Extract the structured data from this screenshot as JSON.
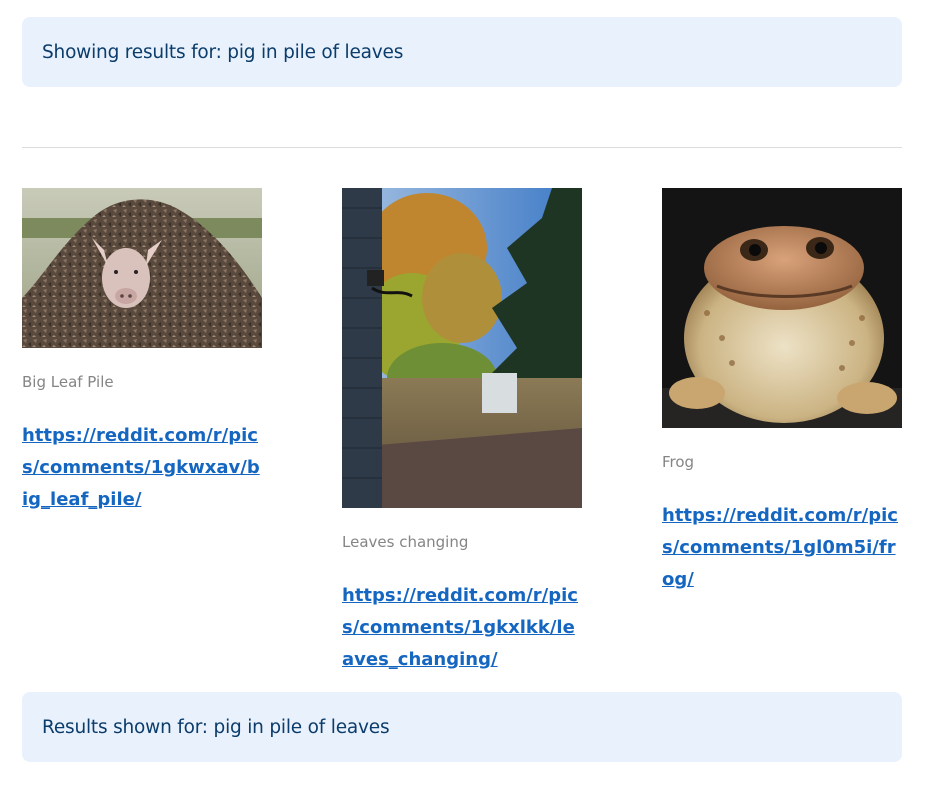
{
  "header": {
    "showing_results": "Showing results for: pig in pile of leaves"
  },
  "results": [
    {
      "title": "Big Leaf Pile",
      "url": "https://reddit.com/r/pics/comments/1gkwxav/big_leaf_pile/",
      "image_alt": "pig in a pile of leaves"
    },
    {
      "title": "Leaves changing",
      "url": "https://reddit.com/r/pics/comments/1gkxlkk/leaves_changing/",
      "image_alt": "autumn trees beside a house"
    },
    {
      "title": "Frog",
      "url": "https://reddit.com/r/pics/comments/1gl0m5i/frog/",
      "image_alt": "toad at night"
    }
  ],
  "footer": {
    "results_shown": "Results shown for: pig in pile of leaves"
  }
}
